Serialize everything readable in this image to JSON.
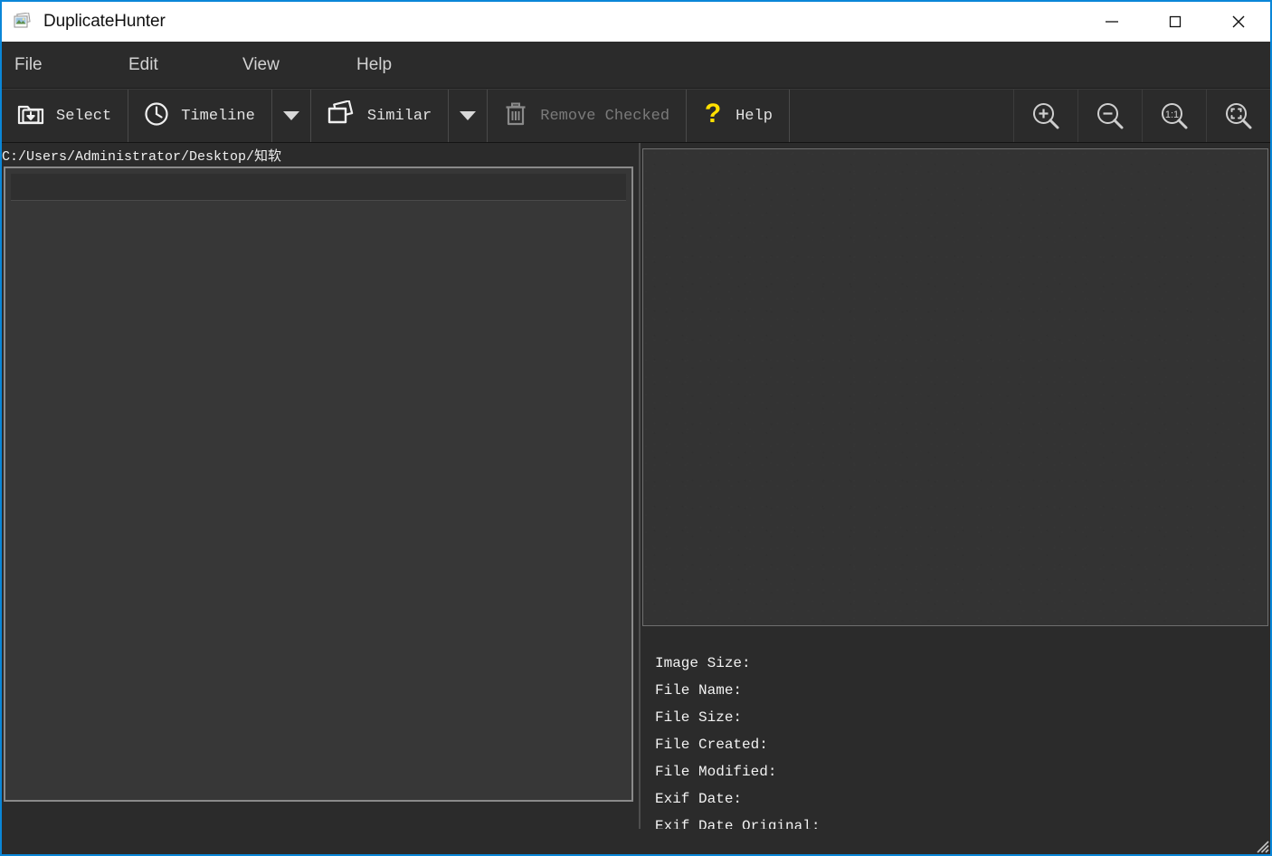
{
  "window": {
    "title": "DuplicateHunter",
    "app_icon": "photo-stack-icon",
    "border_color": "#0a86d8",
    "controls": {
      "minimize": "minimize-icon",
      "maximize": "maximize-icon",
      "close": "close-icon"
    }
  },
  "menubar": {
    "items": [
      {
        "label": "File"
      },
      {
        "label": "Edit"
      },
      {
        "label": "View"
      },
      {
        "label": "Help"
      }
    ]
  },
  "toolbar": {
    "buttons": [
      {
        "label": "Select",
        "icon": "folder-download-icon",
        "enabled": true,
        "has_dropdown": false
      },
      {
        "label": "Timeline",
        "icon": "clock-icon",
        "enabled": true,
        "has_dropdown": true
      },
      {
        "label": "Similar",
        "icon": "photos-stack-icon",
        "enabled": true,
        "has_dropdown": true
      },
      {
        "label": "Remove Checked",
        "icon": "trash-icon",
        "enabled": false,
        "has_dropdown": false
      },
      {
        "label": "Help",
        "icon": "question-mark-icon",
        "enabled": true,
        "has_dropdown": false
      }
    ],
    "help_icon_color": "#ffe000",
    "zoom_buttons": [
      {
        "name": "zoom-in-icon",
        "label": "+"
      },
      {
        "name": "zoom-out-icon",
        "label": "−"
      },
      {
        "name": "zoom-actual-size-icon",
        "label": "1:1"
      },
      {
        "name": "zoom-fit-icon",
        "label": "fit"
      }
    ]
  },
  "path_bar": {
    "path": "C:/Users/Administrator/Desktop/知软"
  },
  "file_list": {
    "items": [],
    "empty": true
  },
  "preview": {
    "image_loaded": false,
    "background_color": "#333333"
  },
  "metadata": {
    "rows": [
      {
        "label": "Image Size:",
        "value": ""
      },
      {
        "label": "File Name:",
        "value": ""
      },
      {
        "label": "File Size:",
        "value": ""
      },
      {
        "label": "File Created:",
        "value": ""
      },
      {
        "label": "File Modified:",
        "value": ""
      },
      {
        "label": "Exif Date:",
        "value": ""
      },
      {
        "label": "Exif Date Original:",
        "value": ""
      }
    ]
  },
  "statusbar": {
    "text": "",
    "grip": "resize-grip-icon"
  }
}
